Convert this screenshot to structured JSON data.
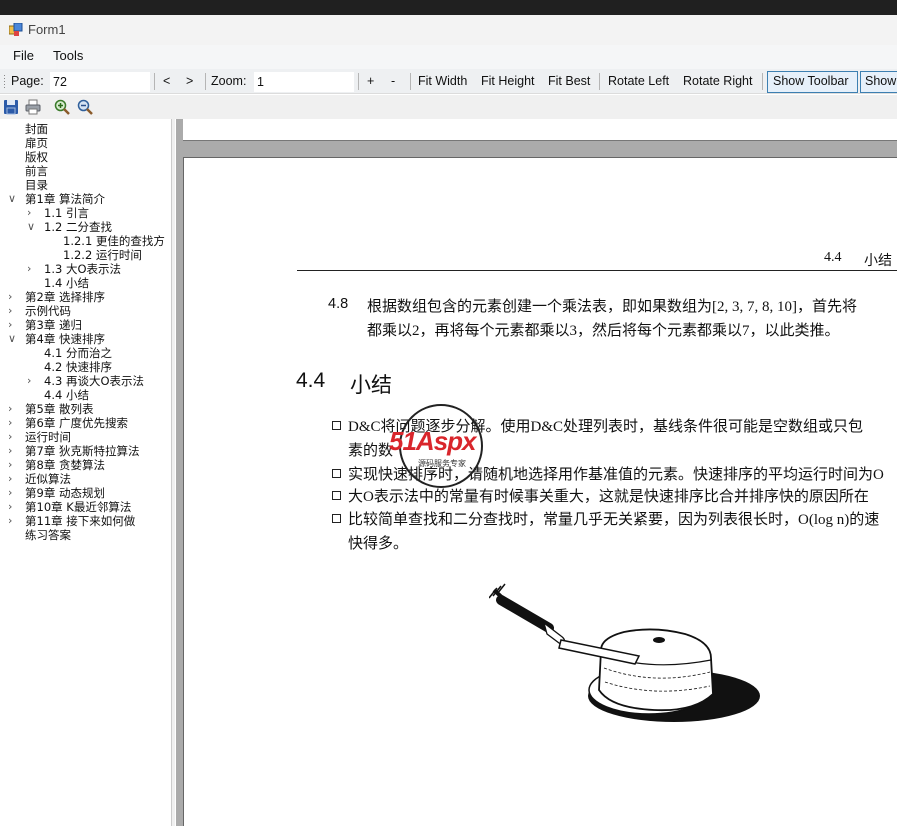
{
  "window": {
    "title": "Form1"
  },
  "menu": {
    "file": "File",
    "tools": "Tools"
  },
  "toolbar": {
    "page_label": "Page:",
    "page_value": "72",
    "prev": "<",
    "next": ">",
    "zoom_label": "Zoom:",
    "zoom_value": "1",
    "zoom_in": "+",
    "zoom_out": "-",
    "fit_width": "Fit Width",
    "fit_height": "Fit Height",
    "fit_best": "Fit Best",
    "rotate_left": "Rotate Left",
    "rotate_right": "Rotate Right",
    "show_toolbar": "Show Toolbar",
    "show_more": "Show"
  },
  "icons": [
    "save-icon",
    "print-icon",
    "zoom-in-icon",
    "zoom-out-icon"
  ],
  "tree": [
    {
      "label": "封面",
      "level": 0,
      "exp": ""
    },
    {
      "label": "扉页",
      "level": 0,
      "exp": ""
    },
    {
      "label": "版权",
      "level": 0,
      "exp": ""
    },
    {
      "label": "前言",
      "level": 0,
      "exp": ""
    },
    {
      "label": "目录",
      "level": 0,
      "exp": ""
    },
    {
      "label": "第1章 算法简介",
      "level": 0,
      "exp": "open"
    },
    {
      "label": "1.1 引言",
      "level": 1,
      "exp": "closed"
    },
    {
      "label": "1.2 二分查找",
      "level": 1,
      "exp": "open"
    },
    {
      "label": "1.2.1 更佳的查找方",
      "level": 2,
      "exp": ""
    },
    {
      "label": "1.2.2 运行时间",
      "level": 2,
      "exp": ""
    },
    {
      "label": "1.3 大O表示法",
      "level": 1,
      "exp": "closed"
    },
    {
      "label": "1.4 小结",
      "level": 1,
      "exp": ""
    },
    {
      "label": "第2章 选择排序",
      "level": 0,
      "exp": "closed"
    },
    {
      "label": "示例代码",
      "level": 0,
      "exp": "closed"
    },
    {
      "label": "第3章 递归",
      "level": 0,
      "exp": "closed"
    },
    {
      "label": "第4章 快速排序",
      "level": 0,
      "exp": "open"
    },
    {
      "label": "4.1 分而治之",
      "level": 1,
      "exp": ""
    },
    {
      "label": "4.2 快速排序",
      "level": 1,
      "exp": ""
    },
    {
      "label": "4.3 再谈大O表示法",
      "level": 1,
      "exp": "closed"
    },
    {
      "label": "4.4 小结",
      "level": 1,
      "exp": ""
    },
    {
      "label": "第5章 散列表",
      "level": 0,
      "exp": "closed"
    },
    {
      "label": "第6章 广度优先搜索",
      "level": 0,
      "exp": "closed"
    },
    {
      "label": "运行时间",
      "level": 0,
      "exp": "closed"
    },
    {
      "label": "第7章 狄克斯特拉算法",
      "level": 0,
      "exp": "closed"
    },
    {
      "label": "第8章 贪婪算法",
      "level": 0,
      "exp": "closed"
    },
    {
      "label": "近似算法",
      "level": 0,
      "exp": "closed"
    },
    {
      "label": "第9章 动态规划",
      "level": 0,
      "exp": "closed"
    },
    {
      "label": "第10章 K最近邻算法",
      "level": 0,
      "exp": "closed"
    },
    {
      "label": "第11章 接下来如何做",
      "level": 0,
      "exp": "closed"
    },
    {
      "label": "练习答案",
      "level": 0,
      "exp": ""
    }
  ],
  "page": {
    "header_num": "4.4",
    "header_title": "小结",
    "exercise_num": "4.8",
    "exercise_line1": "根据数组包含的元素创建一个乘法表，即如果数组为[2, 3, 7, 8, 10]，首先将",
    "exercise_line2": "都乘以2，再将每个元素都乘以3，然后将每个元素都乘以7，以此类推。",
    "section_num": "4.4",
    "section_title": "小结",
    "bullet1_line1": "D&C将问题逐步分解。使用D&C处理列表时，基线条件很可能是空数组或只包",
    "bullet1_line2": "素的数",
    "bullet2": "实现快速排序时，请随机地选择用作基准值的元素。快速排序的平均运行时间为O",
    "bullet3": "大O表示法中的常量有时候事关重大，这就是快速排序比合并排序快的原因所在",
    "bullet4_line1": "比较简单查找和二分查找时，常量几乎无关紧要，因为列表很长时，O(log n)的速",
    "bullet4_line2": "快得多。",
    "watermark_brand": "51Aspx",
    "watermark_sub": "源码服务专家"
  }
}
